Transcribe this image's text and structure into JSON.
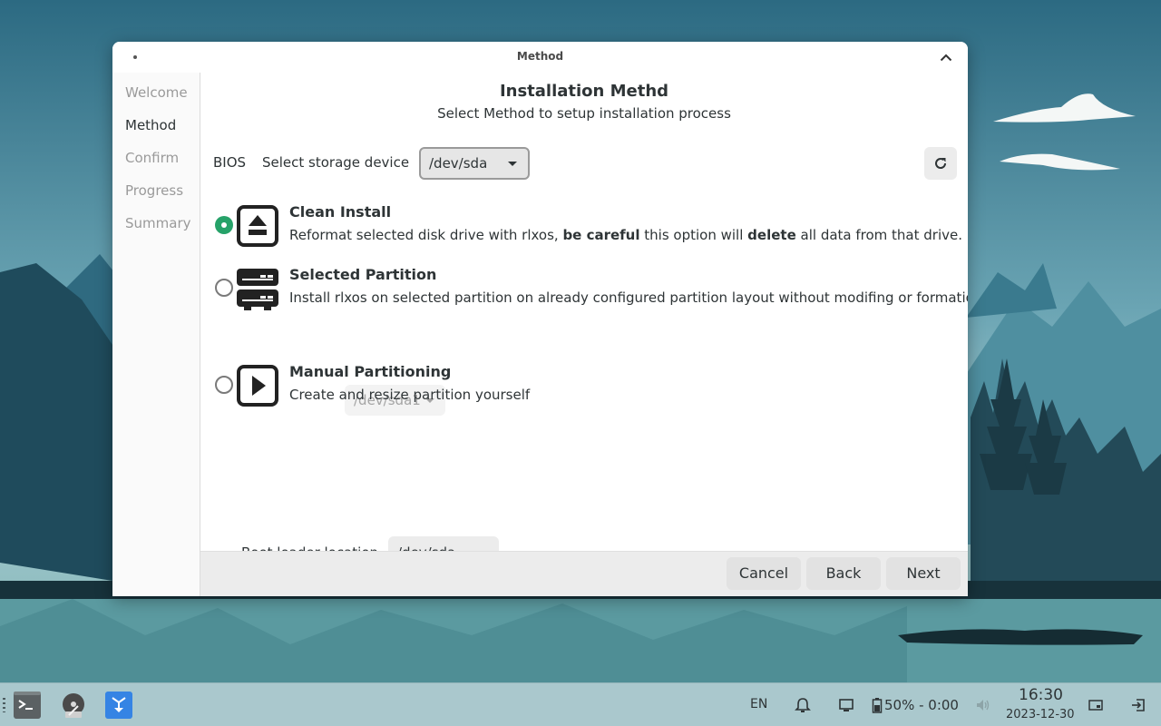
{
  "window": {
    "title": "Method",
    "sidebar": [
      "Welcome",
      "Method",
      "Confirm",
      "Progress",
      "Summary"
    ],
    "active_step": "Method",
    "heading": "Installation Methd",
    "subheading": "Select Method to setup installation process"
  },
  "storage": {
    "firmware_label": "BIOS",
    "select_label": "Select storage device",
    "device": "/dev/sda"
  },
  "options": {
    "clean": {
      "title": "Clean Install",
      "desc_1": "Reformat selected disk drive with rlxos, ",
      "desc_bold_1": "be careful",
      "desc_2": " this option will ",
      "desc_bold_2": "delete",
      "desc_3": " all data from that drive.",
      "selected": true
    },
    "partition": {
      "title": "Selected Partition",
      "desc": "Install rlxos on selected partition on already configured partition layout without modifing or formation",
      "partition_value": "/dev/sda1",
      "selected": false
    },
    "manual": {
      "title": "Manual Partitioning",
      "desc": "Create and resize partition yourself",
      "selected": false
    }
  },
  "bootloader": {
    "label": "Boot loader location",
    "value": "/dev/sda"
  },
  "footer": {
    "cancel": "Cancel",
    "back": "Back",
    "next": "Next"
  },
  "taskbar": {
    "language": "EN",
    "battery": "50% - 0:00",
    "time": "16:30",
    "date": "2023-12-30"
  },
  "colors": {
    "accent_green": "#26a269",
    "taskbar_bg": "#aac8cd"
  }
}
